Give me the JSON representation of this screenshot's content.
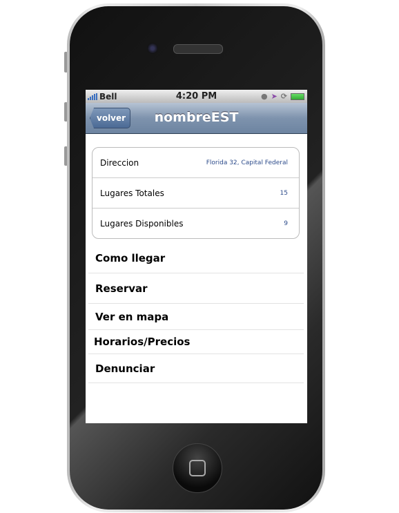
{
  "status": {
    "carrier": "Bell",
    "time": "4:20 PM"
  },
  "nav": {
    "back_label": "volver",
    "title": "nombreEST"
  },
  "details": [
    {
      "label": "Direccion",
      "value": "Florida 32, Capital Federal"
    },
    {
      "label": "Lugares Totales",
      "value": "15"
    },
    {
      "label": "Lugares Disponibles",
      "value": "9"
    }
  ],
  "menu": [
    "Como llegar",
    "Reservar",
    "Ver en mapa",
    "Horarios/Precios",
    "Denunciar"
  ],
  "colors": {
    "nav": "#7e93ad",
    "value_text": "#2b4a8a"
  }
}
